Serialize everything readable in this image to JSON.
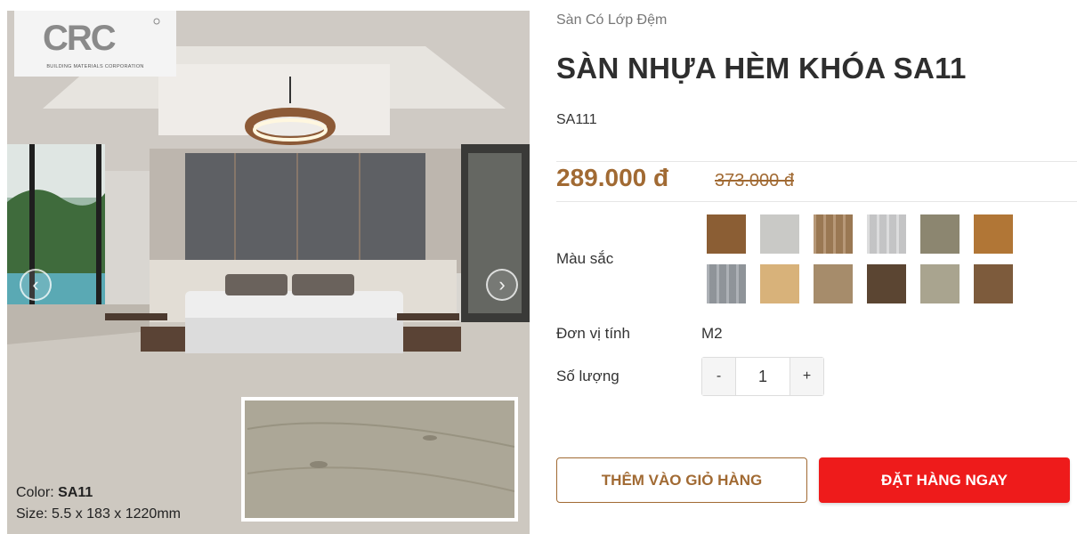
{
  "gallery": {
    "logo_text": "BUILDING MATERIALS CORPORATION",
    "caption": {
      "color_label": "Color:",
      "color_value": "SA11",
      "size_text": "Size: 5.5 x 183 x 1220mm"
    },
    "prev_icon": "chevron-left-icon",
    "next_icon": "chevron-right-icon"
  },
  "product": {
    "category": "Sàn Có Lớp Đệm",
    "title": "SÀN NHỰA HÈM KHÓA SA11",
    "sku": "SA111",
    "price": "289.000 đ",
    "old_price": "373.000 đ",
    "color_label": "Màu sắc",
    "colors": [
      "#8b5e34",
      "#c9c9c6",
      "#a7825a",
      "#d4d5d6",
      "#8c8670",
      "#b17636",
      "#9ba0a6",
      "#d8b27a",
      "#a68c6b",
      "#5b4532",
      "#a9a48f",
      "#7d5b3c"
    ],
    "unit_label": "Đơn vị tính",
    "unit_value": "M2",
    "qty_label": "Số lượng",
    "qty_minus": "-",
    "qty_value": "1",
    "qty_plus": "+",
    "add_to_cart": "THÊM VÀO GIỎ HÀNG",
    "buy_now": "ĐẶT HÀNG NGAY"
  },
  "theme": {
    "accent": "#a16a33",
    "buy": "#ee1b1b"
  }
}
